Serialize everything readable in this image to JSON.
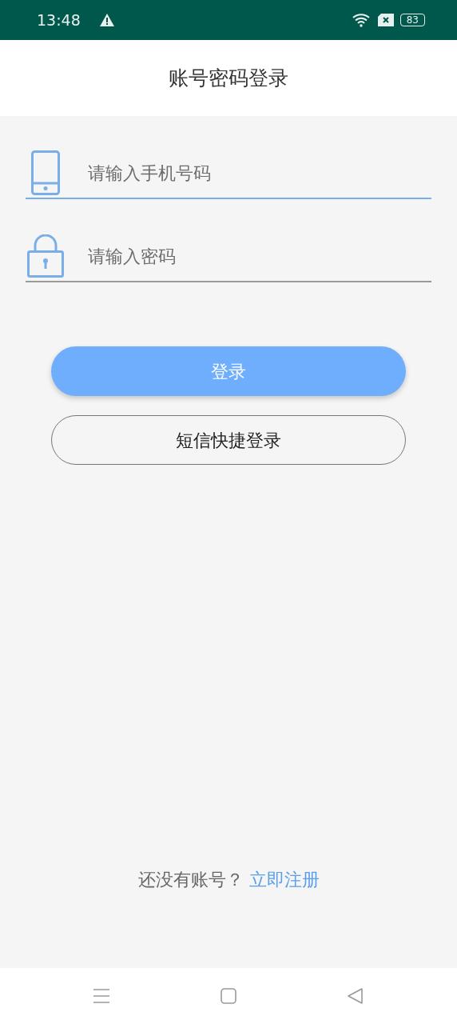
{
  "status_bar": {
    "time": "13:48",
    "battery": "83"
  },
  "header": {
    "title": "账号密码登录"
  },
  "fields": [
    {
      "kind": "phone",
      "placeholder": "请输入手机号码",
      "focused": true
    },
    {
      "kind": "password",
      "placeholder": "请输入密码",
      "focused": false
    }
  ],
  "buttons": [
    {
      "kind": "primary",
      "label": "登录"
    },
    {
      "kind": "outline",
      "label": "短信快捷登录"
    }
  ],
  "footer": {
    "text": "还没有账号？",
    "link": "立即注册"
  }
}
